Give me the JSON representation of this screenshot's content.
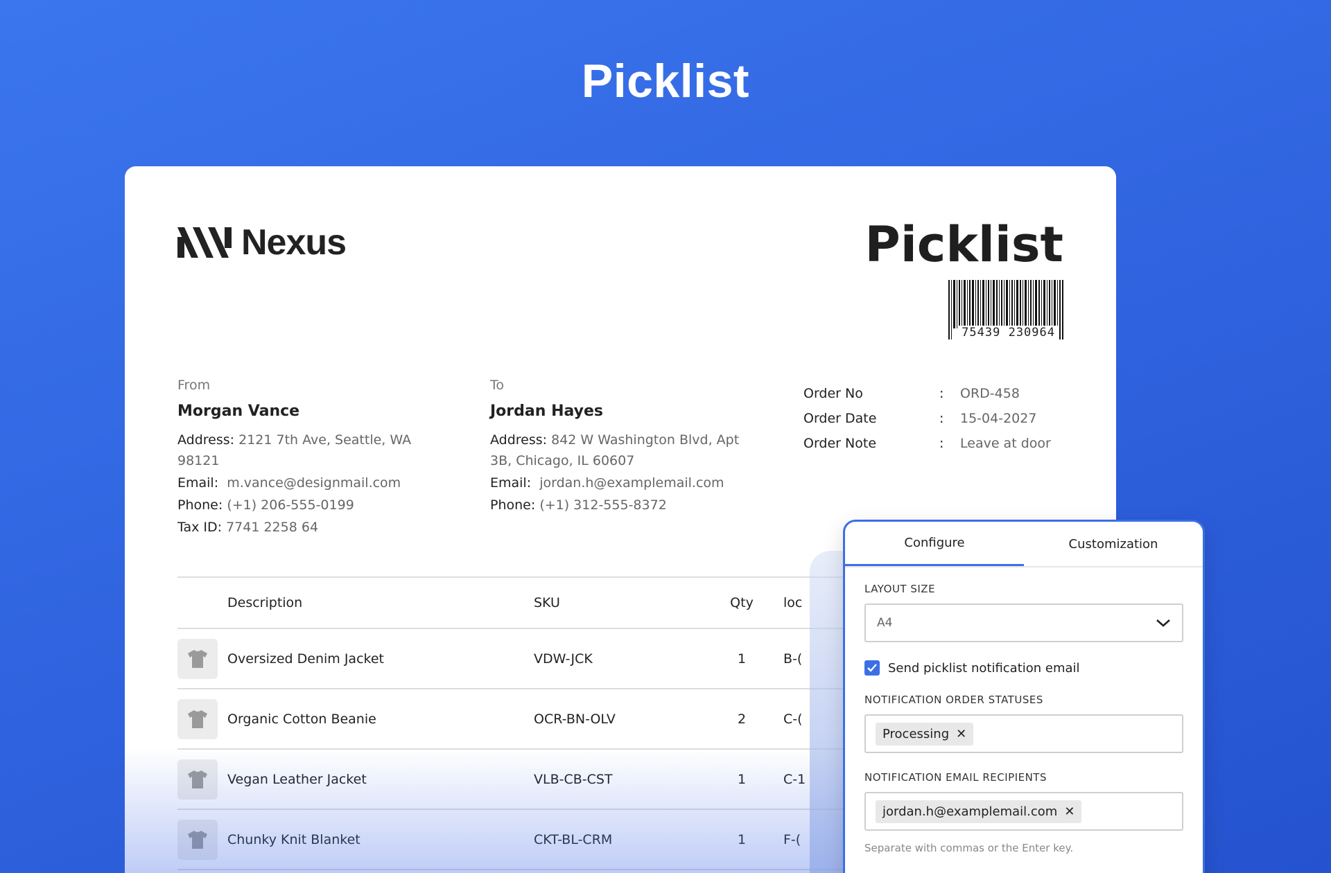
{
  "page": {
    "hero_title": "Picklist"
  },
  "document": {
    "brand_name": "Nexus",
    "title": "Picklist",
    "barcode_number": "75439 230964",
    "from": {
      "label": "From",
      "name": "Morgan Vance",
      "address_key": "Address:",
      "address": "2121 7th Ave, Seattle, WA 98121",
      "email_key": "Email:",
      "email": "m.vance@designmail.com",
      "phone_key": "Phone:",
      "phone": "(+1) 206-555-0199",
      "tax_key": "Tax ID:",
      "tax": "7741 2258 64"
    },
    "to": {
      "label": "To",
      "name": "Jordan Hayes",
      "address_key": "Address:",
      "address": "842 W Washington Blvd, Apt 3B, Chicago, IL 60607",
      "email_key": "Email:",
      "email": "jordan.h@examplemail.com",
      "phone_key": "Phone:",
      "phone": "(+1) 312-555-8372"
    },
    "order": [
      {
        "key": "Order No",
        "value": "ORD-458"
      },
      {
        "key": "Order Date",
        "value": "15-04-2027"
      },
      {
        "key": "Order Note",
        "value": "Leave at door"
      }
    ],
    "table": {
      "headers": {
        "description": "Description",
        "sku": "SKU",
        "qty": "Qty",
        "location": "loc"
      },
      "rows": [
        {
          "description": "Oversized Denim Jacket",
          "sku": "VDW-JCK",
          "qty": "1",
          "location": "B-("
        },
        {
          "description": "Organic Cotton Beanie",
          "sku": "OCR-BN-OLV",
          "qty": "2",
          "location": "C-("
        },
        {
          "description": "Vegan Leather Jacket",
          "sku": "VLB-CB-CST",
          "qty": "1",
          "location": "C-1"
        },
        {
          "description": "Chunky Knit Blanket",
          "sku": "CKT-BL-CRM",
          "qty": "1",
          "location": "F-("
        }
      ]
    }
  },
  "panel": {
    "tabs": [
      "Configure",
      "Customization"
    ],
    "layout_size_label": "LAYOUT SIZE",
    "layout_size_value": "A4",
    "send_email_label": "Send picklist notification email",
    "statuses_label": "NOTIFICATION ORDER STATUSES",
    "status_tag": "Processing",
    "recipients_label": "NOTIFICATION EMAIL RECIPIENTS",
    "recipient_tag": "jordan.h@examplemail.com",
    "hint": "Separate with commas or the Enter key.",
    "accent_color": "#3b6fe6"
  }
}
